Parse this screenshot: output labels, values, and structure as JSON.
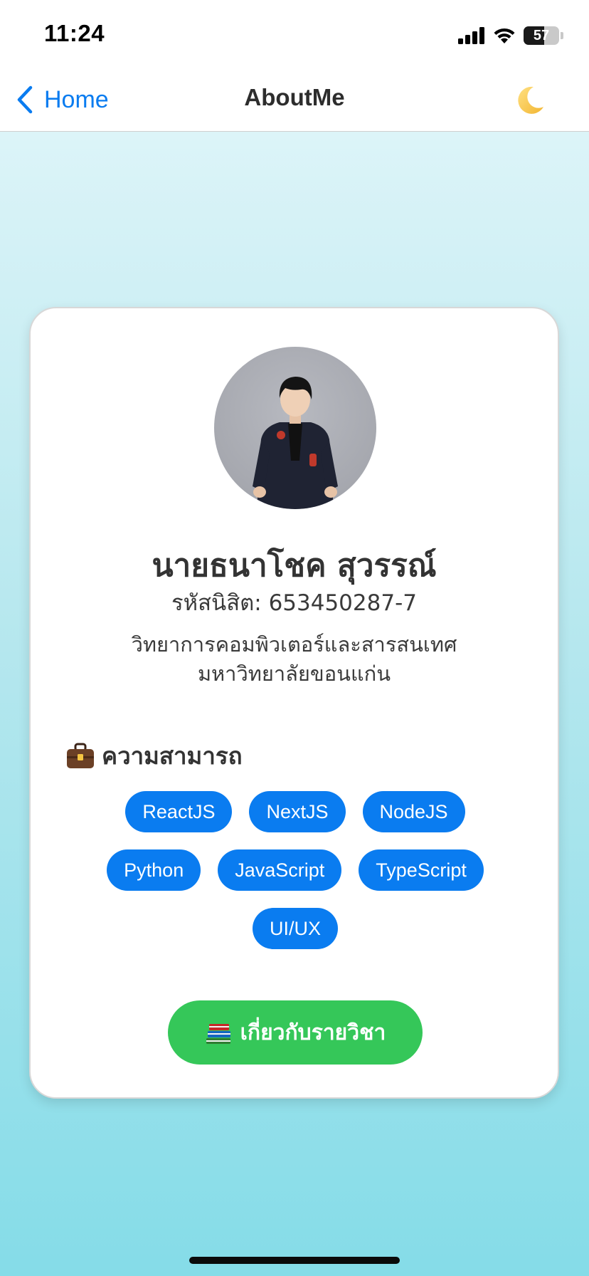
{
  "status_bar": {
    "time": "11:24",
    "battery_level": "57",
    "battery_fraction": 0.57,
    "icons": [
      "cellular-signal-icon",
      "wifi-icon",
      "battery-icon"
    ]
  },
  "nav": {
    "back_label": "Home",
    "title": "AboutMe",
    "back_icon": "chevron-left-icon",
    "theme_icon": "crescent-moon-icon"
  },
  "profile": {
    "name": "นายธนาโชค สุวรรณ์",
    "student_id": "รหัสนิสิต: 653450287-7",
    "department": "วิทยาการคอมพิวเตอร์และสารสนเทศ",
    "university": "มหาวิทยาลัยขอนแก่น"
  },
  "skills": {
    "heading": "ความสามารถ",
    "heading_icon": "briefcase-icon",
    "items": [
      "ReactJS",
      "NextJS",
      "NodeJS",
      "Python",
      "JavaScript",
      "TypeScript",
      "UI/UX"
    ]
  },
  "course_button": {
    "label": "เกี่ยวกับรายวิชา",
    "icon": "books-icon"
  },
  "colors": {
    "accent_blue": "#0a7cf0",
    "button_green": "#35c759",
    "gradient_top": "#dcf4f8",
    "gradient_bottom": "#85dce8"
  }
}
